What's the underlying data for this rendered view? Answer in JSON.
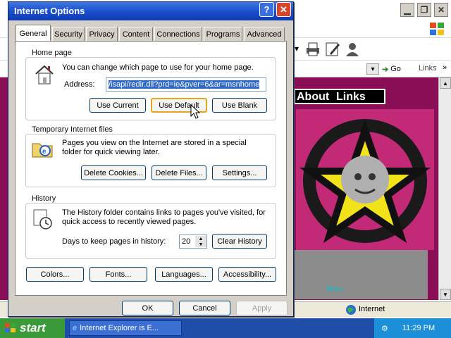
{
  "dialog": {
    "title": "Internet Options",
    "help_glyph": "?",
    "close_glyph": "✕",
    "tabs": [
      "General",
      "Security",
      "Privacy",
      "Content",
      "Connections",
      "Programs",
      "Advanced"
    ],
    "active_tab": "General",
    "home_page": {
      "title": "Home page",
      "description": "You can change which page to use for your home page.",
      "address_label": "Address:",
      "address_value": "/isapi/redir.dll?prd=ie&pver=6&ar=msnhome",
      "buttons": {
        "use_current": "Use Current",
        "use_default": "Use Default",
        "use_blank": "Use Blank"
      }
    },
    "temp_files": {
      "title": "Temporary Internet files",
      "description": "Pages you view on the Internet are stored in a special folder for quick viewing later.",
      "buttons": {
        "delete_cookies": "Delete Cookies...",
        "delete_files": "Delete Files...",
        "settings": "Settings..."
      }
    },
    "history": {
      "title": "History",
      "description": "The History folder contains links to pages you've visited, for quick access to recently viewed pages.",
      "days_label": "Days to keep pages in history:",
      "days_value": "20",
      "clear_button": "Clear History"
    },
    "bottom_buttons": {
      "colors": "Colors...",
      "fonts": "Fonts...",
      "languages": "Languages...",
      "accessibility": "Accessibility..."
    },
    "footer": {
      "ok": "OK",
      "cancel": "Cancel",
      "apply": "Apply"
    }
  },
  "browser": {
    "go_label": "Go",
    "links_label": "Links",
    "nav_about": "About",
    "nav_links": "Links",
    "misc_label": "Misc",
    "status_zone": "Internet"
  },
  "taskbar": {
    "start_label": "start",
    "task_label": "Internet Explorer is E...",
    "clock": "11:29 PM"
  },
  "colors": {
    "title_blue": "#1a4fd0",
    "page_magenta": "#8a0e55",
    "taskbar_blue": "#1f4ea8",
    "start_green": "#3a9a3a",
    "selection_blue": "#3169c6"
  }
}
